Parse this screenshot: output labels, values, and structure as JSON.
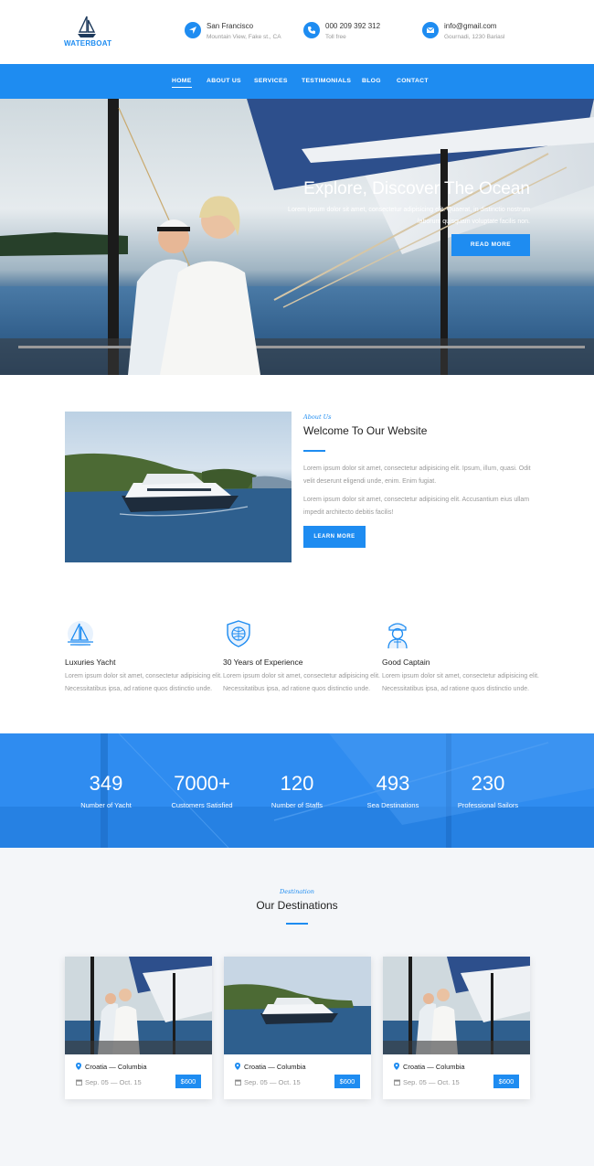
{
  "brand": {
    "name": "WATERBOAT",
    "accent": "#1e8cf1"
  },
  "header": {
    "contacts": [
      {
        "icon": "location-arrow-icon",
        "title": "San Francisco",
        "subtitle": "Mountain View, Fake st., CA"
      },
      {
        "icon": "phone-icon",
        "title": "000 209 392 312",
        "subtitle": "Toll free"
      },
      {
        "icon": "envelope-icon",
        "title": "info@gmail.com",
        "subtitle": "Gournadi, 1230 Bariasl"
      }
    ]
  },
  "nav": {
    "items": [
      "HOME",
      "ABOUT US",
      "SERVICES",
      "TESTIMONIALS",
      "BLOG",
      "CONTACT"
    ],
    "active": "HOME"
  },
  "hero": {
    "title": "Explore, Discover The Ocean",
    "text": "Lorem ipsum dolor sit amet, consectetur adipisicing elit. Quaerat, in distinctio nostrum laborum quisquam voluptate facilis non.",
    "button": "READ MORE"
  },
  "about": {
    "kicker": "About Us",
    "title": "Welcome To Our Website",
    "paragraph1": "Lorem ipsum dolor sit amet, consectetur adipisicing elit. Ipsum, illum, quasi. Odit velit deserunt eligendi unde, enim. Enim fugiat.",
    "paragraph2": "Lorem ipsum dolor sit amet, consectetur adipisicing elit. Accusantium eius ullam impedit architecto debitis facilis!",
    "button": "LEARN MORE"
  },
  "features": [
    {
      "icon": "sailboat-icon",
      "title": "Luxuries Yacht",
      "text": "Lorem ipsum dolor sit amet, consectetur adipisicing elit. Necessitatibus ipsa, ad ratione quos distinctio unde."
    },
    {
      "icon": "shield-icon",
      "title": "30 Years of Experience",
      "text": "Lorem ipsum dolor sit amet, consectetur adipisicing elit. Necessitatibus ipsa, ad ratione quos distinctio unde."
    },
    {
      "icon": "captain-icon",
      "title": "Good Captain",
      "text": "Lorem ipsum dolor sit amet, consectetur adipisicing elit. Necessitatibus ipsa, ad ratione quos distinctio unde."
    }
  ],
  "stats": [
    {
      "value": "349",
      "label": "Number of Yacht"
    },
    {
      "value": "7000+",
      "label": "Customers Satisfied"
    },
    {
      "value": "120",
      "label": "Number of Staffs"
    },
    {
      "value": "493",
      "label": "Sea Destinations"
    },
    {
      "value": "230",
      "label": "Professional Sailors"
    }
  ],
  "destinations": {
    "kicker": "Destination",
    "title": "Our Destinations",
    "cards": [
      {
        "location": "Croatia — Columbia",
        "dates": "Sep. 05 — Oct. 15",
        "price": "$600"
      },
      {
        "location": "Croatia — Columbia",
        "dates": "Sep. 05 — Oct. 15",
        "price": "$600"
      },
      {
        "location": "Croatia — Columbia",
        "dates": "Sep. 05 — Oct. 15",
        "price": "$600"
      }
    ]
  }
}
